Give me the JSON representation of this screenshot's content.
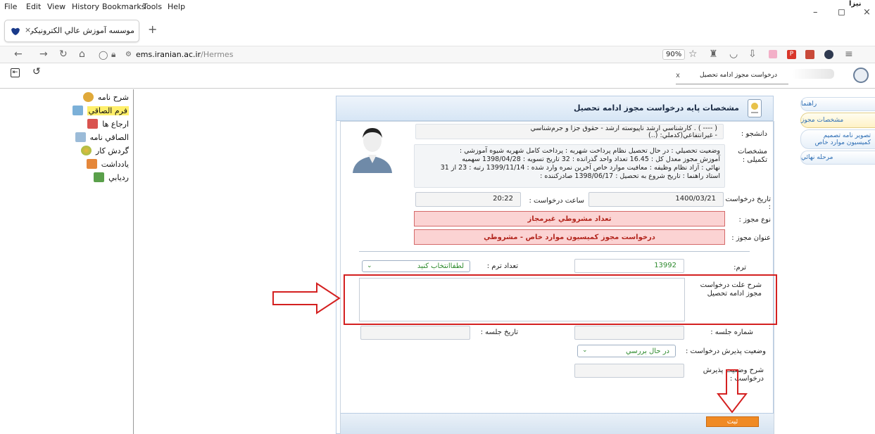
{
  "menubar": {
    "items": [
      "File",
      "Edit",
      "View",
      "History",
      "Bookmarks",
      "Tools",
      "Help"
    ],
    "top_right_text": "نیزا"
  },
  "window_controls": {
    "minimize": "–",
    "restore": "◻",
    "close": "×"
  },
  "tab": {
    "title": "موسسه آموزش عالي الكترونيكي ا",
    "close": "×",
    "new_tab": "+"
  },
  "navbar": {
    "url_domain": "ems.iranian.ac.ir",
    "url_path": "/Hermes",
    "zoom": "90%"
  },
  "app_toolbar": {
    "search_tag": "درخواست مجوز ادامه تحصیل",
    "search_tag_close": "x"
  },
  "sidebar": {
    "items": [
      {
        "label": "شرح نامه",
        "color": "#e0a93a"
      },
      {
        "label": "فرم الصاقي",
        "color": "#7bb0d8",
        "selected": true
      },
      {
        "label": "ارجاع ها",
        "color": "#d9534f"
      },
      {
        "label": "الصاقي نامه",
        "color": "#9bbbd8"
      },
      {
        "label": "گردش کار",
        "color": "#e8b93b"
      },
      {
        "label": "يادداشت",
        "color": "#e5873a"
      },
      {
        "label": "رديابي",
        "color": "#5aa04a"
      }
    ]
  },
  "right_tabs": [
    {
      "label": "راهنما"
    },
    {
      "label": "مشخصات مجوز",
      "active": true
    },
    {
      "label": "تصوير نامه تصميم کميسيون موارد خاص"
    },
    {
      "label": "مرحله نهائي"
    }
  ],
  "panel": {
    "title": "مشخصات پایه درخواست مجوز ادامه تحصیل",
    "student_label": "دانشجو :",
    "student_line1": "( ---- ) . کارشناسي ارشد ناپيوسته ارشد - حقوق جزا و جرم‌شناسي",
    "student_line2": "- غيرانتفاعي(کدملي:        (..)",
    "details_label": "مشخصات تکمیلی :",
    "details_lines": [
      "وضعيت تحصيلي : در حال تحصيل   نظام پرداخت شهريه : پرداخت کامل شهريه   شيوه آموزشي :",
      "آموزش مجوز   معدل کل : 16.45   تعداد واحد گذرانده : 32   تاريخ تسويه : 1398/04/28   سهميه",
      "نهائي : آزاد   نظام وظيفه : معافيت موارد خاص   آخرين نمره وارد شده : 1399/11/14   رتبه : 23 از 31",
      "استاد راهنما :           تاريخ شروع به تحصيل : 1398/06/17   صادرکننده :"
    ],
    "request_date_label": "تاريخ درخواست :",
    "request_date": "1400/03/21",
    "request_time_label": "ساعت درخواست :",
    "request_time": "20:22",
    "permit_type_label": "نوع مجوز :",
    "permit_type": "تعداد مشروطي غيرمجاز",
    "permit_title_label": "عنوان مجوز :",
    "permit_title": "درخواست مجوز کميسيون موارد خاص - مشروطي",
    "term_label": "ترم:",
    "term_value": "13992",
    "term_count_label": "تعداد ترم :",
    "term_count_value": "لطفاانتخاب کنيد",
    "reason_label": "شرح علت درخواست مجوز ادامه تحصيل",
    "session_no_label": "شماره جلسه :",
    "session_date_label": "تاريخ جلسه :",
    "status_label": "وضعيت پذيرش درخواست :",
    "status_value": "در حال بررسي",
    "status_desc_label": "شرح وضعيت پذيرش درخواست :",
    "submit_label": "ثبت"
  },
  "colors": {
    "annotation_red": "#d42020",
    "submit_orange": "#f08a24",
    "panel_blue": "#d7e6f5"
  }
}
